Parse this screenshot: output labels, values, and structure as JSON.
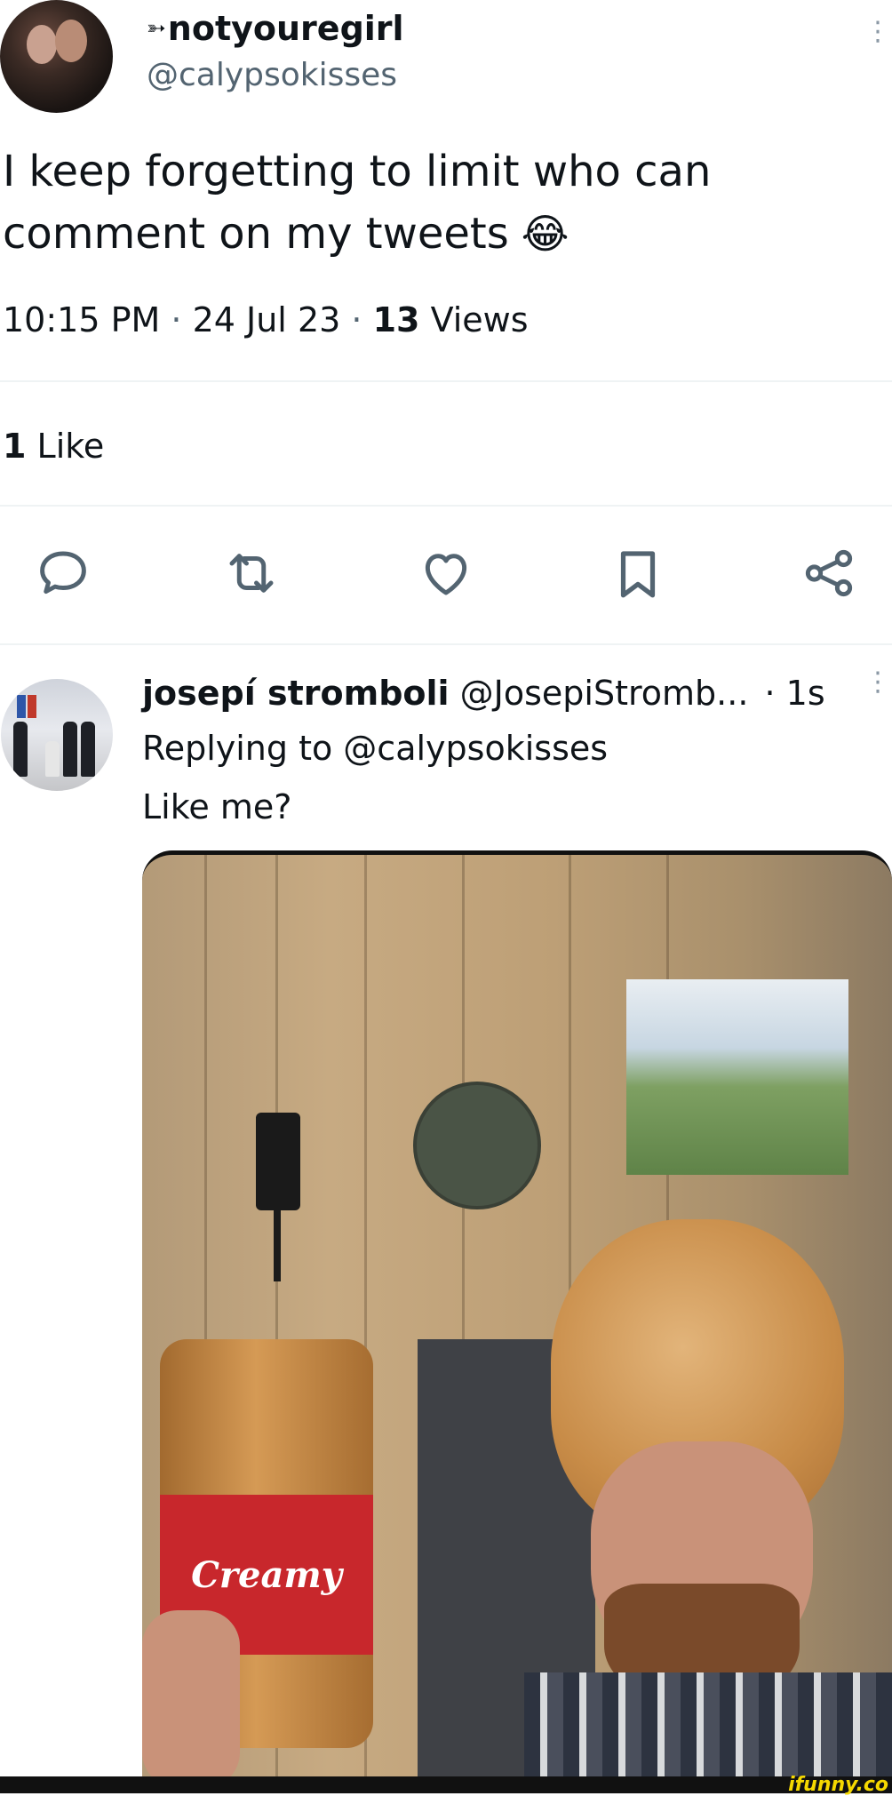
{
  "tweet": {
    "display_name": "notyouregirl",
    "name_prefix_icon": "ribbon-arrow-icon",
    "handle": "@calypsokisses",
    "text_line1": "I keep forgetting to limit who can",
    "text_line2": "comment on my tweets",
    "emoji": "😂",
    "time": "10:15 PM",
    "date": "24 Jul 23",
    "views_count": "13",
    "views_label": "Views",
    "likes_count": "1",
    "likes_label": "Like",
    "separator": "·"
  },
  "actions": [
    {
      "name": "reply-icon"
    },
    {
      "name": "retweet-icon"
    },
    {
      "name": "like-icon"
    },
    {
      "name": "bookmark-icon"
    },
    {
      "name": "share-icon"
    }
  ],
  "reply": {
    "display_name": "josepí stromboli",
    "handle": "@JosepiStromb...",
    "time_ago": "· 1s",
    "replying_to": "Replying to @calypsokisses",
    "text": "Like me?",
    "photo_jar_label": "Creamy"
  },
  "watermark": "ifunny.co",
  "colors": {
    "text": "#0f1419",
    "muted": "#536471",
    "icon": "#536471",
    "divider": "#eff3f4",
    "watermark": "#f5d800"
  }
}
